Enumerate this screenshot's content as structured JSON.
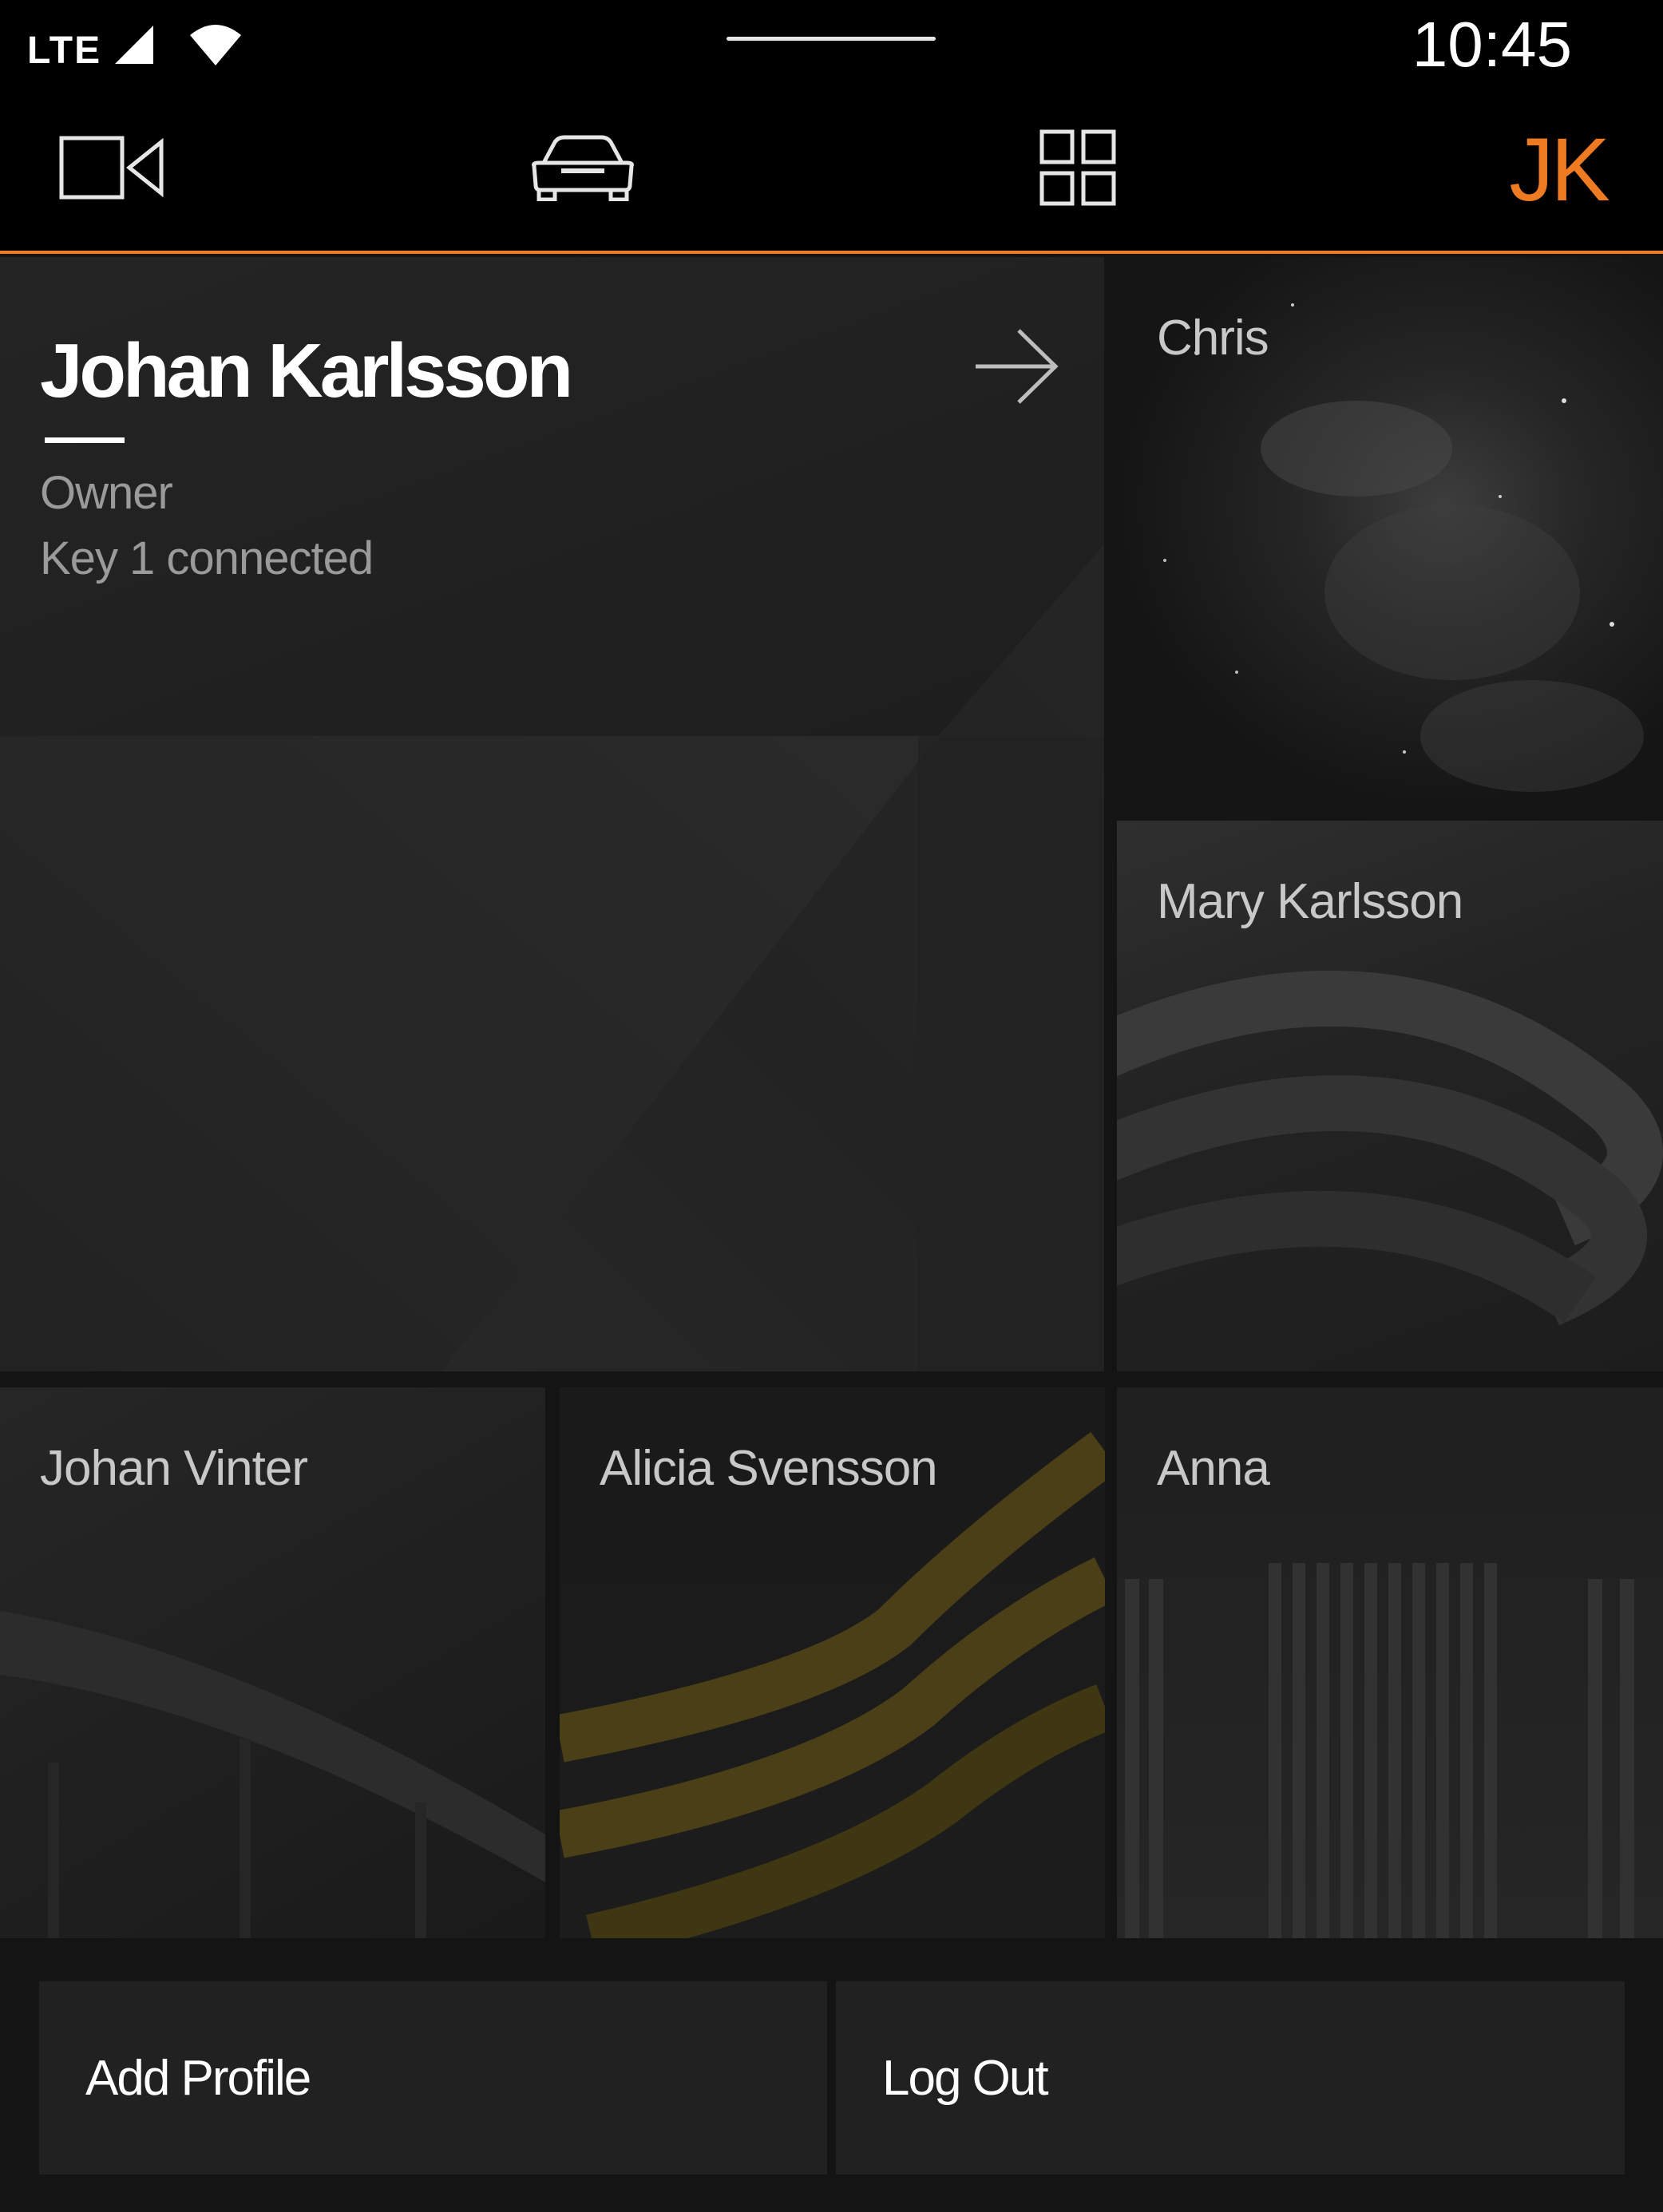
{
  "status_bar": {
    "network": "LTE",
    "time": "10:45",
    "icons": [
      "signal-icon",
      "wifi-icon"
    ]
  },
  "nav": {
    "items": [
      {
        "name": "camera-icon"
      },
      {
        "name": "car-icon"
      },
      {
        "name": "apps-grid-icon"
      }
    ],
    "initials": "JK",
    "accent_color": "#ee7a22"
  },
  "active_profile": {
    "name": "Johan Karlsson",
    "role": "Owner",
    "key_status": "Key 1 connected",
    "icon": "arrow-right-icon"
  },
  "profiles": [
    {
      "name": "Chris"
    },
    {
      "name": "Mary Karlsson"
    },
    {
      "name": "Johan Vinter"
    },
    {
      "name": "Alicia Svensson"
    },
    {
      "name": "Anna"
    }
  ],
  "actions": {
    "add_profile": "Add Profile",
    "log_out": "Log Out"
  }
}
